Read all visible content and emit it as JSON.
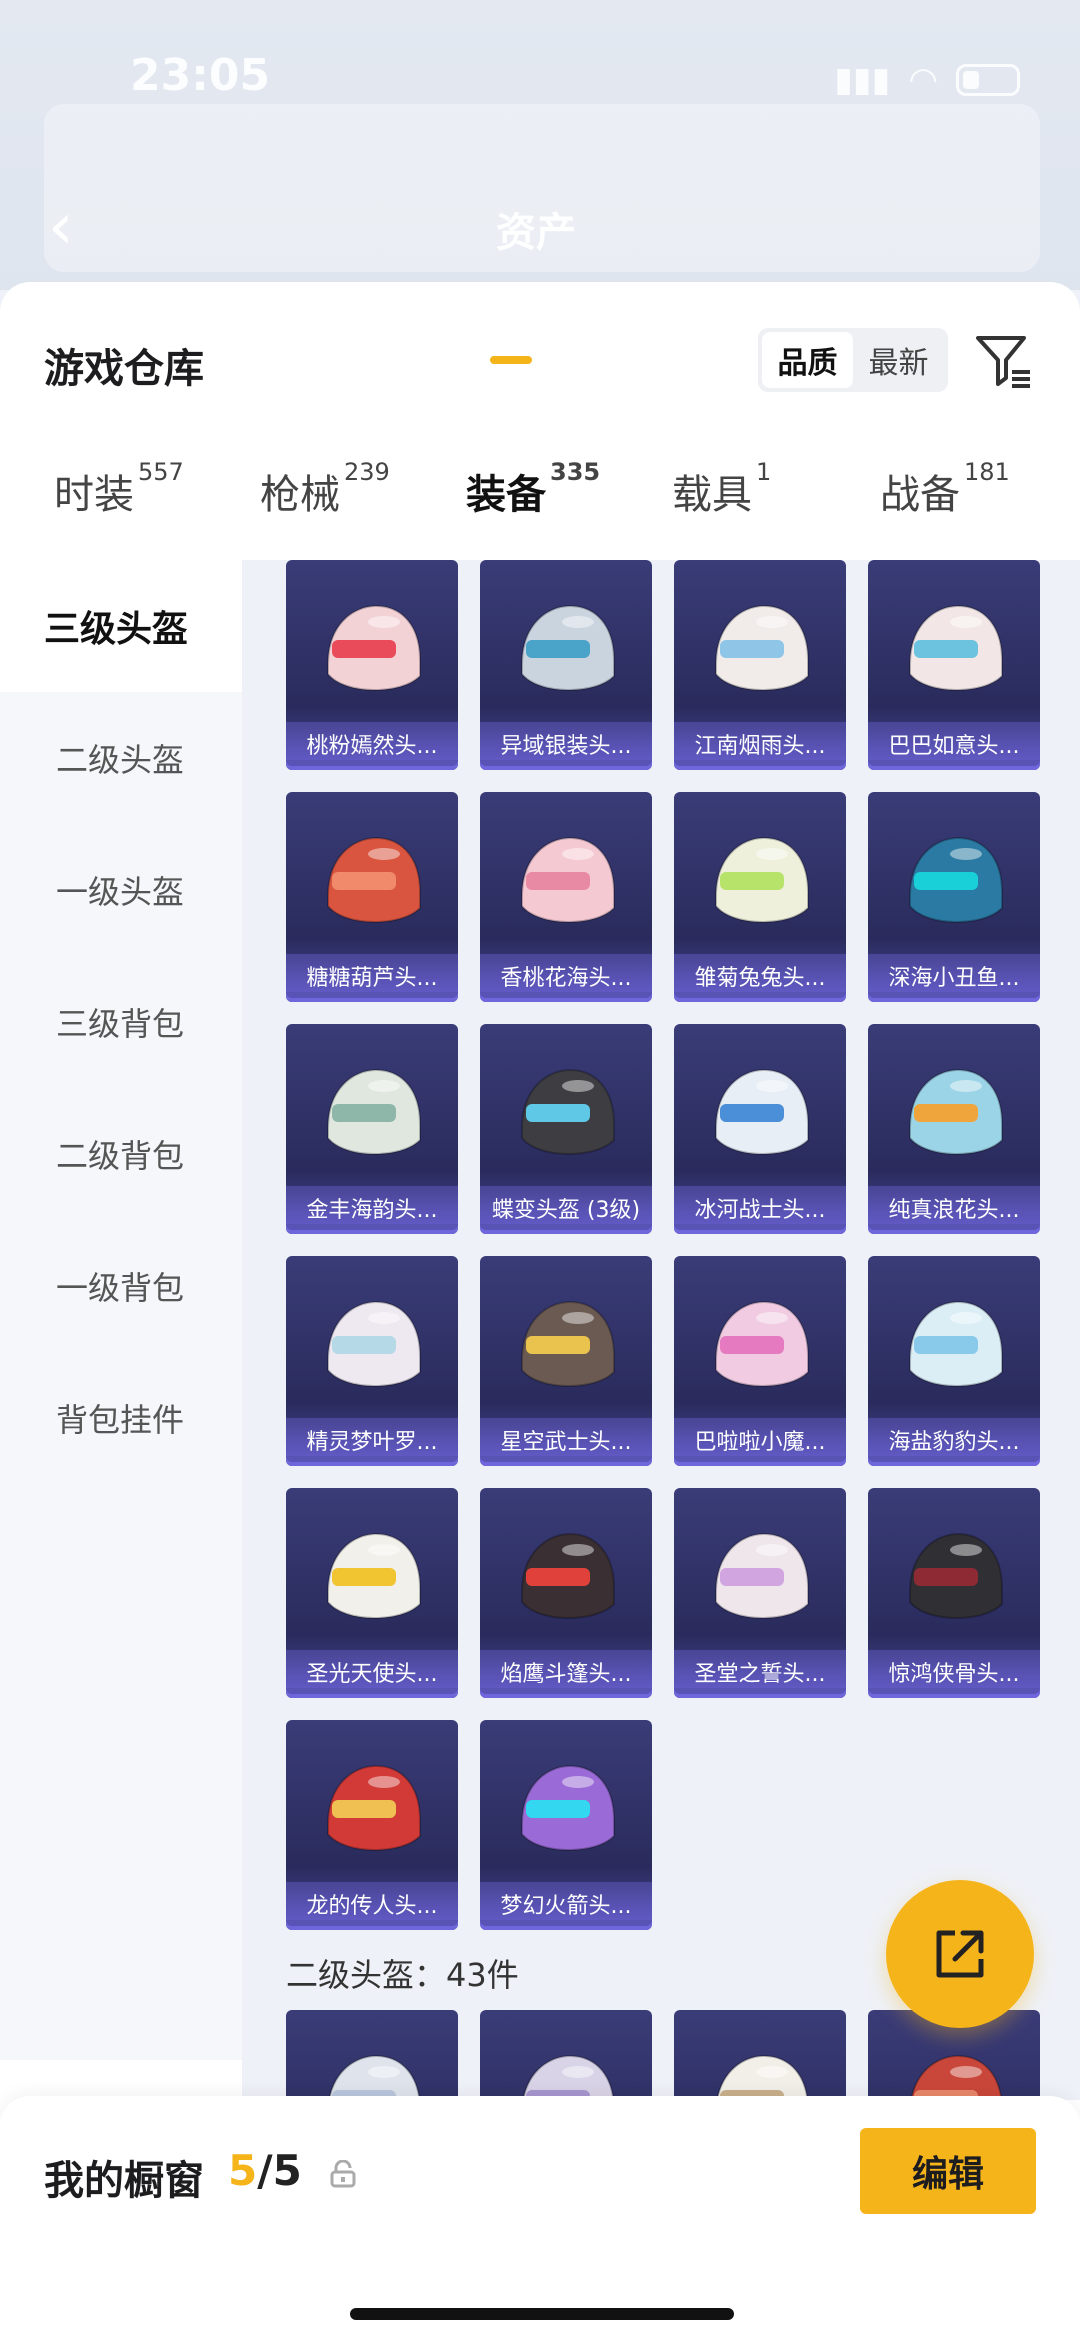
{
  "status_bar": {
    "time": "23:05"
  },
  "background": {
    "title": "资产"
  },
  "sheet": {
    "title": "游戏仓库",
    "sort": {
      "quality": "品质",
      "latest": "最新"
    }
  },
  "tabs": [
    {
      "label": "时装",
      "count": "557"
    },
    {
      "label": "枪械",
      "count": "239"
    },
    {
      "label": "装备",
      "count": "335"
    },
    {
      "label": "载具",
      "count": "1"
    },
    {
      "label": "战备",
      "count": "181"
    }
  ],
  "sidebar": [
    {
      "label": "三级头盔"
    },
    {
      "label": "二级头盔"
    },
    {
      "label": "一级头盔"
    },
    {
      "label": "三级背包"
    },
    {
      "label": "二级背包"
    },
    {
      "label": "一级背包"
    },
    {
      "label": "背包挂件"
    }
  ],
  "items": [
    {
      "name": "桃粉嫣然头...",
      "color": "#f3d2d6",
      "accent": "#e94b5a"
    },
    {
      "name": "异域银装头...",
      "color": "#c9d4df",
      "accent": "#4aa3c9"
    },
    {
      "name": "江南烟雨头...",
      "color": "#f1ece9",
      "accent": "#8fc6e8"
    },
    {
      "name": "巴巴如意头...",
      "color": "#f2e7e6",
      "accent": "#6cc3e0"
    },
    {
      "name": "糖糖葫芦头...",
      "color": "#d9553f",
      "accent": "#f08a6b"
    },
    {
      "name": "香桃花海头...",
      "color": "#f4c9d2",
      "accent": "#e88aa3"
    },
    {
      "name": "雏菊兔兔头...",
      "color": "#eef0dc",
      "accent": "#b7e36b"
    },
    {
      "name": "深海小丑鱼...",
      "color": "#2a7aa3",
      "accent": "#1ad0d8"
    },
    {
      "name": "金丰海韵头...",
      "color": "#dfe7df",
      "accent": "#8fb7a9"
    },
    {
      "name": "蝶变头盔 (3级)",
      "color": "#3d3d42",
      "accent": "#5ec8e6"
    },
    {
      "name": "冰河战士头...",
      "color": "#e8eef6",
      "accent": "#4b8fd8"
    },
    {
      "name": "纯真浪花头...",
      "color": "#9bd4e6",
      "accent": "#f0a53c"
    },
    {
      "name": "精灵梦叶罗...",
      "color": "#eee8f0",
      "accent": "#b6d9e8"
    },
    {
      "name": "星空武士头...",
      "color": "#6b5a52",
      "accent": "#e9c34e"
    },
    {
      "name": "巴啦啦小魔...",
      "color": "#f0cbe2",
      "accent": "#e67ac0"
    },
    {
      "name": "海盐豹豹头...",
      "color": "#dbeef6",
      "accent": "#89c9ea"
    },
    {
      "name": "圣光天使头...",
      "color": "#f2f0ea",
      "accent": "#f1c531"
    },
    {
      "name": "焰鹰斗篷头...",
      "color": "#3a2f32",
      "accent": "#e0413b"
    },
    {
      "name": "圣堂之誓头...",
      "color": "#efe6ec",
      "accent": "#d1a6e0"
    },
    {
      "name": "惊鸿侠骨头...",
      "color": "#2f2f34",
      "accent": "#8e2a34"
    },
    {
      "name": "龙的传人头...",
      "color": "#d13a37",
      "accent": "#f0c052"
    },
    {
      "name": "梦幻火箭头...",
      "color": "#9a6bd6",
      "accent": "#33d8f0"
    },
    {
      "name": "",
      "color": "#dfe4ec",
      "accent": "#b9c6dc"
    },
    {
      "name": "",
      "color": "#d8d3e6",
      "accent": "#a796cf"
    },
    {
      "name": "",
      "color": "#f1efe8",
      "accent": "#c9b08b"
    },
    {
      "name": "",
      "color": "#c9473a",
      "accent": "#e8876a"
    }
  ],
  "section": {
    "label": "二级头盔：43件"
  },
  "showcase": {
    "label": "我的橱窗",
    "current": "5",
    "total": "/5"
  },
  "edit_button": {
    "label": "编辑"
  },
  "icons": {
    "back": "back-chevron-icon",
    "filter": "filter-icon",
    "share": "share-icon",
    "lock": "lock-icon"
  }
}
